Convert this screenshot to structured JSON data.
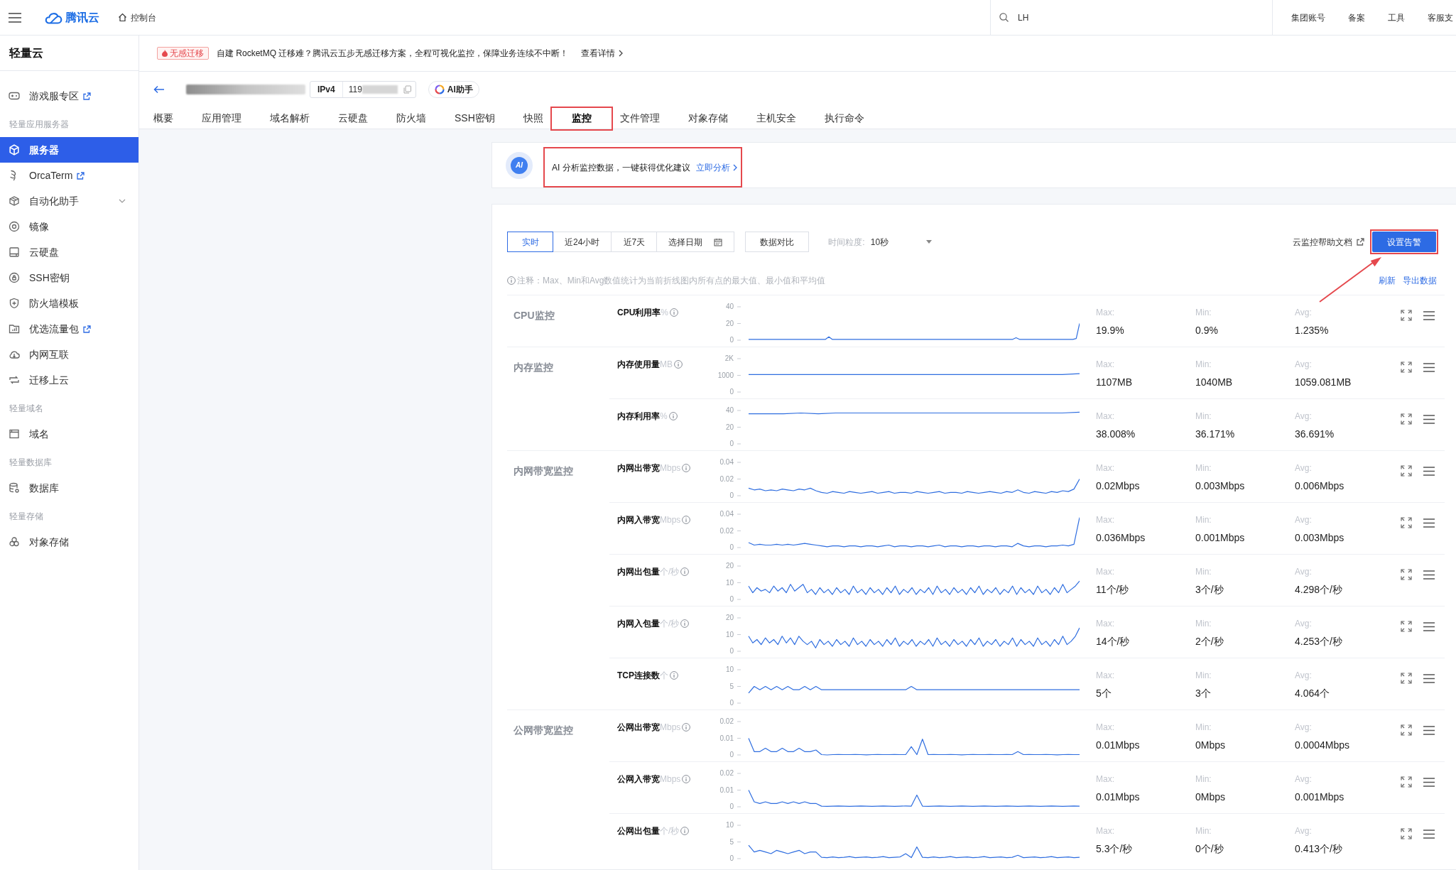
{
  "topbar": {
    "logo": "腾讯云",
    "console": "控制台",
    "search_value": "LH",
    "links": [
      "集团账号",
      "备案",
      "工具",
      "客服支"
    ]
  },
  "sidebar": {
    "title": "轻量云",
    "items": [
      {
        "kind": "link",
        "label": "游戏服专区",
        "selected": false,
        "external": true
      },
      {
        "kind": "section",
        "label": "轻量应用服务器"
      },
      {
        "kind": "link",
        "label": "服务器",
        "selected": true,
        "external": false
      },
      {
        "kind": "link",
        "label": "OrcaTerm",
        "selected": false,
        "external": true
      },
      {
        "kind": "menu",
        "label": "自动化助手",
        "selected": false,
        "external": false,
        "expanded": false
      },
      {
        "kind": "link",
        "label": "镜像",
        "selected": false,
        "external": false
      },
      {
        "kind": "link",
        "label": "云硬盘",
        "selected": false,
        "external": false
      },
      {
        "kind": "link",
        "label": "SSH密钥",
        "selected": false,
        "external": false
      },
      {
        "kind": "link",
        "label": "防火墙模板",
        "selected": false,
        "external": false
      },
      {
        "kind": "link",
        "label": "优选流量包",
        "selected": false,
        "external": true
      },
      {
        "kind": "link",
        "label": "内网互联",
        "selected": false,
        "external": false
      },
      {
        "kind": "link",
        "label": "迁移上云",
        "selected": false,
        "external": false
      },
      {
        "kind": "section",
        "label": "轻量域名"
      },
      {
        "kind": "link",
        "label": "域名",
        "selected": false,
        "external": false
      },
      {
        "kind": "section",
        "label": "轻量数据库"
      },
      {
        "kind": "link",
        "label": "数据库",
        "selected": false,
        "external": false
      },
      {
        "kind": "section",
        "label": "轻量存储"
      },
      {
        "kind": "link",
        "label": "对象存储",
        "selected": false,
        "external": false
      }
    ]
  },
  "banner": {
    "tag": "无感迁移",
    "text": "自建 RocketMQ 迁移难？腾讯云五步无感迁移方案，全程可视化监控，保障业务连续不中断！",
    "link": "查看详情"
  },
  "instance": {
    "ip_version": "IPv4",
    "ip_visible": "119",
    "assistant": "AI助手"
  },
  "tabs": [
    {
      "label": "概要",
      "selected": false,
      "highlighted": false
    },
    {
      "label": "应用管理",
      "selected": false,
      "highlighted": false
    },
    {
      "label": "域名解析",
      "selected": false,
      "highlighted": false
    },
    {
      "label": "云硬盘",
      "selected": false,
      "highlighted": false
    },
    {
      "label": "防火墙",
      "selected": false,
      "highlighted": false
    },
    {
      "label": "SSH密钥",
      "selected": false,
      "highlighted": false
    },
    {
      "label": "快照",
      "selected": false,
      "highlighted": false
    },
    {
      "label": "监控",
      "selected": true,
      "highlighted": true
    },
    {
      "label": "文件管理",
      "selected": false,
      "highlighted": false
    },
    {
      "label": "对象存储",
      "selected": false,
      "highlighted": false
    },
    {
      "label": "主机安全",
      "selected": false,
      "highlighted": false
    },
    {
      "label": "执行命令",
      "selected": false,
      "highlighted": false
    }
  ],
  "ai_prompt": {
    "badge": "AI",
    "text": "AI 分析监控数据，一键获得优化建议",
    "link": "立即分析",
    "highlighted": true
  },
  "toolbar": {
    "ranges": [
      {
        "kind": "preset",
        "label": "实时",
        "selected": true
      },
      {
        "kind": "preset",
        "label": "近24小时",
        "selected": false
      },
      {
        "kind": "preset",
        "label": "近7天",
        "selected": false
      },
      {
        "kind": "date",
        "label": "选择日期",
        "selected": false
      }
    ],
    "compare": "数据对比",
    "granularity_label": "时间粒度:",
    "granularity_value": "10秒",
    "help_link": "云监控帮助文档",
    "alarm_button": {
      "label": "设置告警",
      "highlighted": true
    }
  },
  "note": "注释：Max、Min和Avg数值统计为当前折线图内所有点的最大值、最小值和平均值",
  "actions": [
    "刷新",
    "导出数据"
  ],
  "groups": [
    {
      "title": "CPU监控",
      "metrics": [
        {
          "name": "CPU利用率",
          "unit": "%",
          "stats": [
            {
              "label": "Max:",
              "value": "19.9%"
            },
            {
              "label": "Min:",
              "value": "0.9%"
            },
            {
              "label": "Avg:",
              "value": "1.235%"
            }
          ],
          "chart_data": {
            "type": "line",
            "ylim": [
              0,
              40
            ],
            "yticks": [
              0,
              20,
              40
            ],
            "series": [
              {
                "color": "#2f6ee0",
                "values": [
                  1,
                  1,
                  1,
                  1,
                  1,
                  1,
                  1,
                  1,
                  1,
                  1,
                  1,
                  1,
                  1,
                  1,
                  1,
                  1,
                  1,
                  1,
                  1,
                  1,
                  1,
                  1,
                  1,
                  1,
                  4,
                  1,
                  1,
                  1,
                  1,
                  1,
                  1,
                  1,
                  1,
                  1,
                  1,
                  1,
                  1,
                  1,
                  1,
                  1,
                  1,
                  1,
                  1,
                  1,
                  1,
                  1,
                  1,
                  1,
                  1,
                  1,
                  1,
                  1,
                  1,
                  1,
                  1,
                  1,
                  1,
                  1,
                  1,
                  1,
                  1,
                  1,
                  1,
                  1,
                  1,
                  1,
                  1,
                  1,
                  1,
                  1,
                  1,
                  1,
                  1,
                  1,
                  1,
                  1,
                  1,
                  1,
                  1,
                  1,
                  3,
                  1,
                  1,
                  1,
                  1,
                  1,
                  1,
                  1,
                  1,
                  1,
                  1,
                  1,
                  1,
                  1,
                  1,
                  1,
                  1,
                  1,
                  2,
                  20
                ]
              }
            ]
          }
        }
      ]
    },
    {
      "title": "内存监控",
      "metrics": [
        {
          "name": "内存使用量",
          "unit": "MB",
          "stats": [
            {
              "label": "Max:",
              "value": "1107MB"
            },
            {
              "label": "Min:",
              "value": "1040MB"
            },
            {
              "label": "Avg:",
              "value": "1059.081MB"
            }
          ],
          "chart_data": {
            "type": "line",
            "ylim": [
              0,
              2000
            ],
            "yticks": [
              0,
              1000,
              {
                "value": 2000,
                "label": "2K"
              }
            ],
            "series": [
              {
                "color": "#2f6ee0",
                "values": [
                  1050,
                  1050,
                  1050,
                  1050,
                  1050,
                  1050,
                  1050,
                  1050,
                  1050,
                  1050,
                  1050,
                  1050,
                  1050,
                  1050,
                  1050,
                  1050,
                  1050,
                  1050,
                  1050,
                  1100
                ]
              }
            ]
          }
        },
        {
          "name": "内存利用率",
          "unit": "%",
          "stats": [
            {
              "label": "Max:",
              "value": "38.008%"
            },
            {
              "label": "Min:",
              "value": "36.171%"
            },
            {
              "label": "Avg:",
              "value": "36.691%"
            }
          ],
          "chart_data": {
            "type": "line",
            "ylim": [
              0,
              40
            ],
            "yticks": [
              0,
              20,
              40
            ],
            "series": [
              {
                "color": "#2f6ee0",
                "values": [
                  36,
                  36,
                  36,
                  37,
                  36,
                  37,
                  37,
                  37,
                  37,
                  37,
                  37,
                  37,
                  37,
                  37,
                  37,
                  37,
                  37,
                  37,
                  37,
                  38
                ]
              }
            ]
          }
        }
      ]
    },
    {
      "title": "内网带宽监控",
      "metrics": [
        {
          "name": "内网出带宽",
          "unit": "Mbps",
          "stats": [
            {
              "label": "Max:",
              "value": "0.02Mbps"
            },
            {
              "label": "Min:",
              "value": "0.003Mbps"
            },
            {
              "label": "Avg:",
              "value": "0.006Mbps"
            }
          ],
          "chart_data": {
            "type": "line",
            "ylim": [
              0,
              0.04
            ],
            "yticks": [
              0,
              0.02,
              0.04
            ],
            "series": [
              {
                "color": "#2f6ee0",
                "values": [
                  0.009,
                  0.007,
                  0.008,
                  0.006,
                  0.007,
                  0.006,
                  0.008,
                  0.007,
                  0.006,
                  0.008,
                  0.007,
                  0.009,
                  0.006,
                  0.004,
                  0.003,
                  0.005,
                  0.004,
                  0.003,
                  0.005,
                  0.004,
                  0.003,
                  0.004,
                  0.005,
                  0.003,
                  0.004,
                  0.005,
                  0.003,
                  0.004,
                  0.004,
                  0.003,
                  0.005,
                  0.004,
                  0.003,
                  0.004,
                  0.005,
                  0.003,
                  0.004,
                  0.004,
                  0.003,
                  0.005,
                  0.004,
                  0.003,
                  0.004,
                  0.005,
                  0.004,
                  0.003,
                  0.005,
                  0.004,
                  0.007,
                  0.004,
                  0.003,
                  0.005,
                  0.004,
                  0.003,
                  0.005,
                  0.004,
                  0.006,
                  0.005,
                  0.008,
                  0.02
                ]
              }
            ]
          }
        },
        {
          "name": "内网入带宽",
          "unit": "Mbps",
          "stats": [
            {
              "label": "Max:",
              "value": "0.036Mbps"
            },
            {
              "label": "Min:",
              "value": "0.001Mbps"
            },
            {
              "label": "Avg:",
              "value": "0.003Mbps"
            }
          ],
          "chart_data": {
            "type": "line",
            "ylim": [
              0,
              0.04
            ],
            "yticks": [
              0,
              0.02,
              0.04
            ],
            "series": [
              {
                "color": "#2f6ee0",
                "values": [
                  0.006,
                  0.003,
                  0.004,
                  0.003,
                  0.003,
                  0.004,
                  0.003,
                  0.004,
                  0.003,
                  0.004,
                  0.005,
                  0.004,
                  0.003,
                  0.002,
                  0.001,
                  0.002,
                  0.002,
                  0.001,
                  0.002,
                  0.002,
                  0.001,
                  0.002,
                  0.002,
                  0.001,
                  0.002,
                  0.003,
                  0.001,
                  0.002,
                  0.002,
                  0.001,
                  0.002,
                  0.002,
                  0.001,
                  0.002,
                  0.003,
                  0.001,
                  0.002,
                  0.002,
                  0.001,
                  0.002,
                  0.002,
                  0.001,
                  0.002,
                  0.002,
                  0.001,
                  0.002,
                  0.002,
                  0.001,
                  0.005,
                  0.002,
                  0.001,
                  0.002,
                  0.002,
                  0.001,
                  0.002,
                  0.002,
                  0.003,
                  0.002,
                  0.004,
                  0.036
                ]
              }
            ]
          }
        },
        {
          "name": "内网出包量",
          "unit": "个/秒",
          "stats": [
            {
              "label": "Max:",
              "value": "11个/秒"
            },
            {
              "label": "Min:",
              "value": "3个/秒"
            },
            {
              "label": "Avg:",
              "value": "4.298个/秒"
            }
          ],
          "chart_data": {
            "type": "line",
            "ylim": [
              0,
              20
            ],
            "yticks": [
              0,
              10,
              20
            ],
            "series": [
              {
                "color": "#2f6ee0",
                "values": [
                  8,
                  4,
                  7,
                  5,
                  6,
                  4,
                  8,
                  5,
                  7,
                  4,
                  9,
                  5,
                  7,
                  9,
                  4,
                  6,
                  3,
                  7,
                  4,
                  6,
                  3,
                  7,
                  4,
                  6,
                  3,
                  8,
                  4,
                  6,
                  3,
                  7,
                  4,
                  6,
                  3,
                  7,
                  4,
                  8,
                  3,
                  6,
                  4,
                  7,
                  3,
                  6,
                  4,
                  7,
                  3,
                  8,
                  4,
                  6,
                  3,
                  7,
                  4,
                  6,
                  3,
                  7,
                  4,
                  8,
                  3,
                  6,
                  4,
                  7,
                  3,
                  6,
                  4,
                  8,
                  3,
                  7,
                  4,
                  6,
                  3,
                  8,
                  4,
                  6,
                  3,
                  7,
                  4,
                  9,
                  4,
                  6,
                  8,
                  11
                ]
              }
            ]
          }
        },
        {
          "name": "内网入包量",
          "unit": "个/秒",
          "stats": [
            {
              "label": "Max:",
              "value": "14个/秒"
            },
            {
              "label": "Min:",
              "value": "2个/秒"
            },
            {
              "label": "Avg:",
              "value": "4.253个/秒"
            }
          ],
          "chart_data": {
            "type": "line",
            "ylim": [
              0,
              20
            ],
            "yticks": [
              0,
              10,
              20
            ],
            "series": [
              {
                "color": "#2f6ee0",
                "values": [
                  9,
                  5,
                  7,
                  4,
                  8,
                  5,
                  7,
                  4,
                  9,
                  5,
                  8,
                  4,
                  9,
                  6,
                  4,
                  6,
                  2,
                  7,
                  4,
                  6,
                  3,
                  7,
                  4,
                  6,
                  3,
                  8,
                  4,
                  6,
                  3,
                  7,
                  4,
                  6,
                  3,
                  7,
                  4,
                  8,
                  3,
                  6,
                  4,
                  7,
                  3,
                  6,
                  4,
                  7,
                  3,
                  8,
                  4,
                  6,
                  3,
                  7,
                  4,
                  6,
                  3,
                  7,
                  4,
                  8,
                  3,
                  6,
                  4,
                  7,
                  3,
                  6,
                  4,
                  8,
                  3,
                  7,
                  4,
                  6,
                  3,
                  8,
                  4,
                  6,
                  3,
                  7,
                  4,
                  9,
                  4,
                  6,
                  9,
                  14
                ]
              }
            ]
          }
        },
        {
          "name": "TCP连接数",
          "unit": "个",
          "stats": [
            {
              "label": "Max:",
              "value": "5个"
            },
            {
              "label": "Min:",
              "value": "3个"
            },
            {
              "label": "Avg:",
              "value": "4.064个"
            }
          ],
          "chart_data": {
            "type": "line",
            "ylim": [
              0,
              10
            ],
            "yticks": [
              0,
              5,
              10
            ],
            "series": [
              {
                "color": "#2f6ee0",
                "values": [
                  3,
                  5,
                  4,
                  5,
                  4,
                  5,
                  4,
                  5,
                  4,
                  4,
                  5,
                  4,
                  5,
                  4,
                  4,
                  4,
                  4,
                  4,
                  4,
                  4,
                  4,
                  4,
                  4,
                  4,
                  4,
                  4,
                  4,
                  4,
                  4,
                  5,
                  4,
                  4,
                  4,
                  4,
                  4,
                  4,
                  4,
                  4,
                  4,
                  4,
                  4,
                  4,
                  4,
                  4,
                  4,
                  4,
                  4,
                  4,
                  4,
                  4,
                  4,
                  4,
                  4,
                  4,
                  4,
                  4,
                  4,
                  4,
                  4,
                  4
                ]
              }
            ]
          }
        }
      ]
    },
    {
      "title": "公网带宽监控",
      "metrics": [
        {
          "name": "公网出带宽",
          "unit": "Mbps",
          "stats": [
            {
              "label": "Max:",
              "value": "0.01Mbps"
            },
            {
              "label": "Min:",
              "value": "0Mbps"
            },
            {
              "label": "Avg:",
              "value": "0.0004Mbps"
            }
          ],
          "chart_data": {
            "type": "line",
            "ylim": [
              0,
              0.02
            ],
            "yticks": [
              0,
              0.01,
              0.02
            ],
            "series": [
              {
                "color": "#2f6ee0",
                "values": [
                  0.01,
                  0.002,
                  0.002,
                  0.004,
                  0.002,
                  0.002,
                  0.004,
                  0.002,
                  0.002,
                  0.004,
                  0.002,
                  0.002,
                  0.003,
                  0.0002,
                  0,
                  0.0002,
                  0.0003,
                  0.0002,
                  0.0002,
                  0.0003,
                  0.0002,
                  0.0001,
                  0.0002,
                  0.0003,
                  0.0002,
                  0.0002,
                  0.0003,
                  0.0002,
                  0.0002,
                  0.005,
                  0.0002,
                  0.0095,
                  0.0002,
                  0.0003,
                  0.0002,
                  0.0002,
                  0.0003,
                  0.0002,
                  0.0001,
                  0.0002,
                  0.0003,
                  0.0002,
                  0.0002,
                  0.0003,
                  0.0002,
                  0.0002,
                  0.0003,
                  0.0002,
                  0.002,
                  0.0002,
                  0.0003,
                  0.0002,
                  0.0002,
                  0.0003,
                  0.0002,
                  0.0001,
                  0.0002,
                  0.0003,
                  0.0002,
                  0.0002
                ]
              }
            ]
          }
        },
        {
          "name": "公网入带宽",
          "unit": "Mbps",
          "stats": [
            {
              "label": "Max:",
              "value": "0.01Mbps"
            },
            {
              "label": "Min:",
              "value": "0Mbps"
            },
            {
              "label": "Avg:",
              "value": "0.001Mbps"
            }
          ],
          "chart_data": {
            "type": "line",
            "ylim": [
              0,
              0.02
            ],
            "yticks": [
              0,
              0.01,
              0.02
            ],
            "series": [
              {
                "color": "#2f6ee0",
                "values": [
                  0.01,
                  0.003,
                  0.002,
                  0.003,
                  0.002,
                  0.002,
                  0.003,
                  0.002,
                  0.003,
                  0.002,
                  0.003,
                  0.002,
                  0.002,
                  0.0004,
                  0.0003,
                  0.0004,
                  0.0005,
                  0.0004,
                  0.0003,
                  0.0004,
                  0.0005,
                  0.0004,
                  0.0003,
                  0.0004,
                  0.0005,
                  0.0004,
                  0.0003,
                  0.0004,
                  0.0005,
                  0.0004,
                  0.007,
                  0.0004,
                  0.0003,
                  0.0004,
                  0.0005,
                  0.0004,
                  0.0003,
                  0.0004,
                  0.0005,
                  0.0004,
                  0.0003,
                  0.0004,
                  0.0005,
                  0.0004,
                  0.0003,
                  0.0004,
                  0.0005,
                  0.0004,
                  0.0003,
                  0.0004,
                  0.0005,
                  0.0004,
                  0.0003,
                  0.0004,
                  0.0005,
                  0.0004,
                  0.0003,
                  0.0004,
                  0.0005,
                  0.0004
                ]
              }
            ]
          }
        },
        {
          "name": "公网出包量",
          "unit": "个/秒",
          "stats": [
            {
              "label": "Max:",
              "value": "5.3个/秒"
            },
            {
              "label": "Min:",
              "value": "0个/秒"
            },
            {
              "label": "Avg:",
              "value": "0.413个/秒"
            }
          ],
          "chart_data": {
            "type": "line",
            "ylim": [
              0,
              10
            ],
            "yticks": [
              0,
              5,
              10
            ],
            "series": [
              {
                "color": "#2f6ee0",
                "values": [
                  4,
                  2,
                  2.5,
                  2,
                  1.5,
                  2.5,
                  2,
                  1.5,
                  2,
                  2.5,
                  1.5,
                  2,
                  2,
                  0.4,
                  0.3,
                  0.5,
                  0.3,
                  0.4,
                  0.6,
                  0.3,
                  0.4,
                  0.5,
                  0.3,
                  0.4,
                  0.6,
                  0.3,
                  0.4,
                  0.5,
                  1.5,
                  0.3,
                  3.5,
                  0.4,
                  0.3,
                  0.5,
                  0.3,
                  0.4,
                  0.6,
                  0.3,
                  0.4,
                  0.5,
                  0.3,
                  0.4,
                  0.6,
                  0.3,
                  0.4,
                  0.5,
                  0.3,
                  0.4,
                  1,
                  0.3,
                  0.4,
                  0.5,
                  0.3,
                  0.4,
                  0.6,
                  0.3,
                  0.4,
                  0.5,
                  0.3,
                  0.4
                ]
              }
            ]
          }
        }
      ]
    }
  ]
}
